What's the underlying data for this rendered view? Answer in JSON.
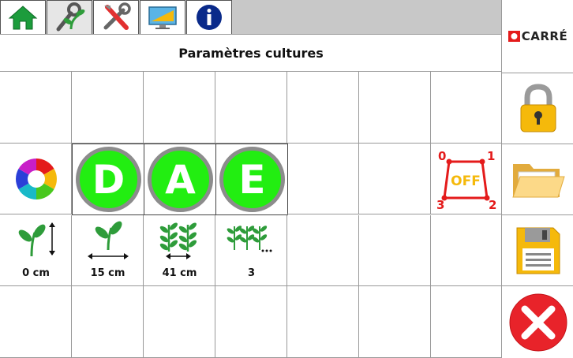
{
  "tabs": [
    {
      "name": "home-icon",
      "active": false
    },
    {
      "name": "crop-settings-icon",
      "active": true
    },
    {
      "name": "tools-icon",
      "active": false
    },
    {
      "name": "display-settings-icon",
      "active": false
    },
    {
      "name": "info-icon",
      "active": false
    }
  ],
  "logo": {
    "text": "CARRÉ"
  },
  "page_title": "Paramètres cultures",
  "buttons": {
    "row_d": "D",
    "row_a": "A",
    "row_e": "E"
  },
  "section_switch": {
    "state": "OFF",
    "corner_0": "0",
    "corner_1": "1",
    "corner_2": "2",
    "corner_3": "3"
  },
  "crop_params": [
    {
      "icon": "plant-height-icon",
      "value": "0 cm"
    },
    {
      "icon": "plant-spacing-icon",
      "value": "15 cm"
    },
    {
      "icon": "row-spacing-icon",
      "value": "41 cm"
    },
    {
      "icon": "row-count-icon",
      "value": "3"
    }
  ],
  "side_buttons": [
    "lock-icon",
    "open-folder-icon",
    "save-icon",
    "close-icon"
  ],
  "colors": {
    "button_green": "#22ee11",
    "close_red": "#e8232a",
    "lock_yellow": "#f5b90b",
    "plant_green": "#2e9c3a",
    "switch_red": "#e41b1b",
    "switch_yellow": "#f5b90b"
  }
}
